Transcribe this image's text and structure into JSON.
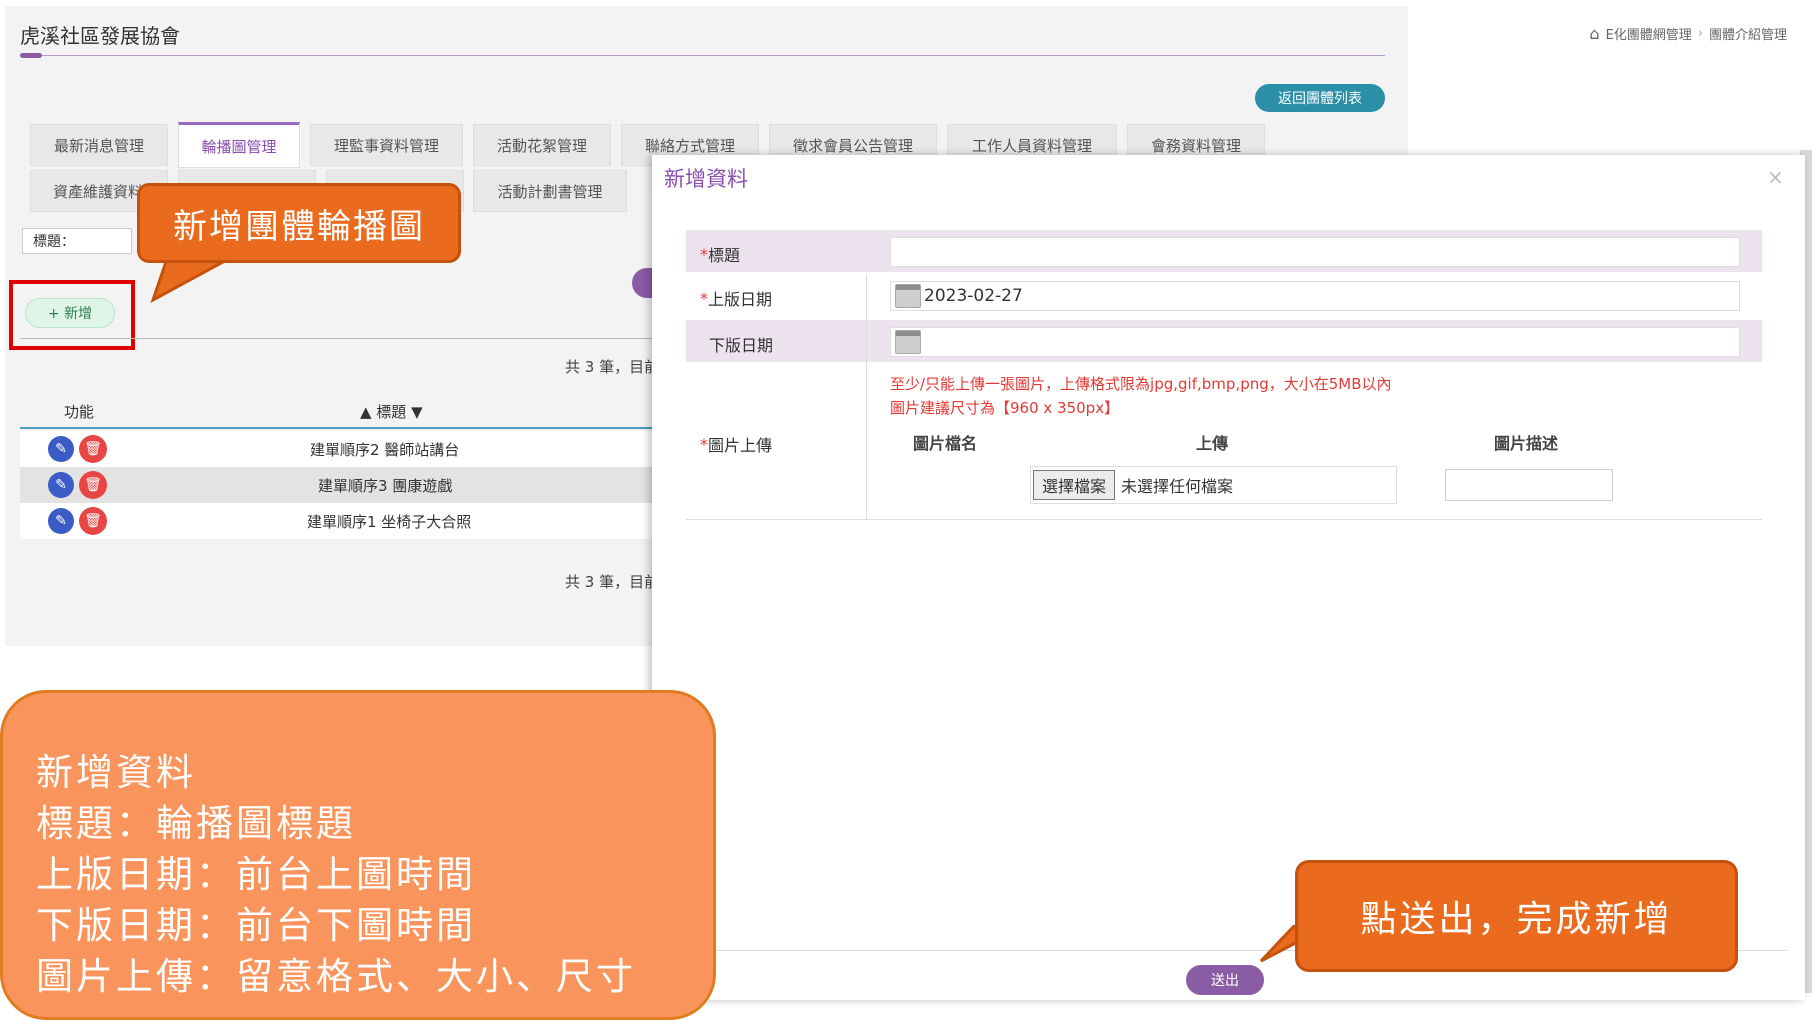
{
  "header": {
    "org": "虎溪社區發展協會",
    "breadcrumb_1": "E化團體網管理",
    "breadcrumb_2": "團體介紹管理",
    "back_button": "返回團體列表"
  },
  "tabs": [
    {
      "label": "最新消息管理"
    },
    {
      "label": "輪播圖管理"
    },
    {
      "label": "理監事資料管理"
    },
    {
      "label": "活動花絮管理"
    },
    {
      "label": "聯絡方式管理"
    },
    {
      "label": "徵求會員公告管理"
    },
    {
      "label": "工作人員資料管理"
    },
    {
      "label": "會務資料管理"
    },
    {
      "label": "資產維護資料"
    },
    {
      "label": "活動計劃書管理"
    }
  ],
  "search": {
    "label": "標題："
  },
  "add_button": "+ 新增",
  "list": {
    "count_text": "共 3 筆，目前",
    "col_func": "功能",
    "col_title": "▲ 標題 ▼",
    "rows": [
      {
        "title": "建單順序2 醫師站講台"
      },
      {
        "title": "建單順序3 團康遊戲"
      },
      {
        "title": "建單順序1 坐椅子大合照"
      }
    ]
  },
  "callout_add": "新增團體輪播圖",
  "modal": {
    "title": "新增資料",
    "close": "×",
    "title_label": "標題",
    "start_label": "上版日期",
    "start_value": "2023-02-27",
    "end_label": "下版日期",
    "upload_label": "圖片上傳",
    "note_1": "至少/只能上傳一張圖片，上傳格式限為jpg,gif,bmp,png，大小在5MB以內",
    "note_2": "圖片建議尺寸為【960 x 350px】",
    "col_filename": "圖片檔名",
    "col_upload": "上傳",
    "col_desc": "圖片描述",
    "file_button": "選擇檔案",
    "file_status": "未選擇任何檔案",
    "submit": "送出"
  },
  "callout_submit": "點送出，完成新增",
  "info_box": {
    "line1": "新增資料",
    "line2": "標題：輪播圖標題",
    "line3": "上版日期：前台上圖時間",
    "line4": "下版日期：前台下圖時間",
    "line5": "圖片上傳：留意格式、大小、尺寸"
  }
}
